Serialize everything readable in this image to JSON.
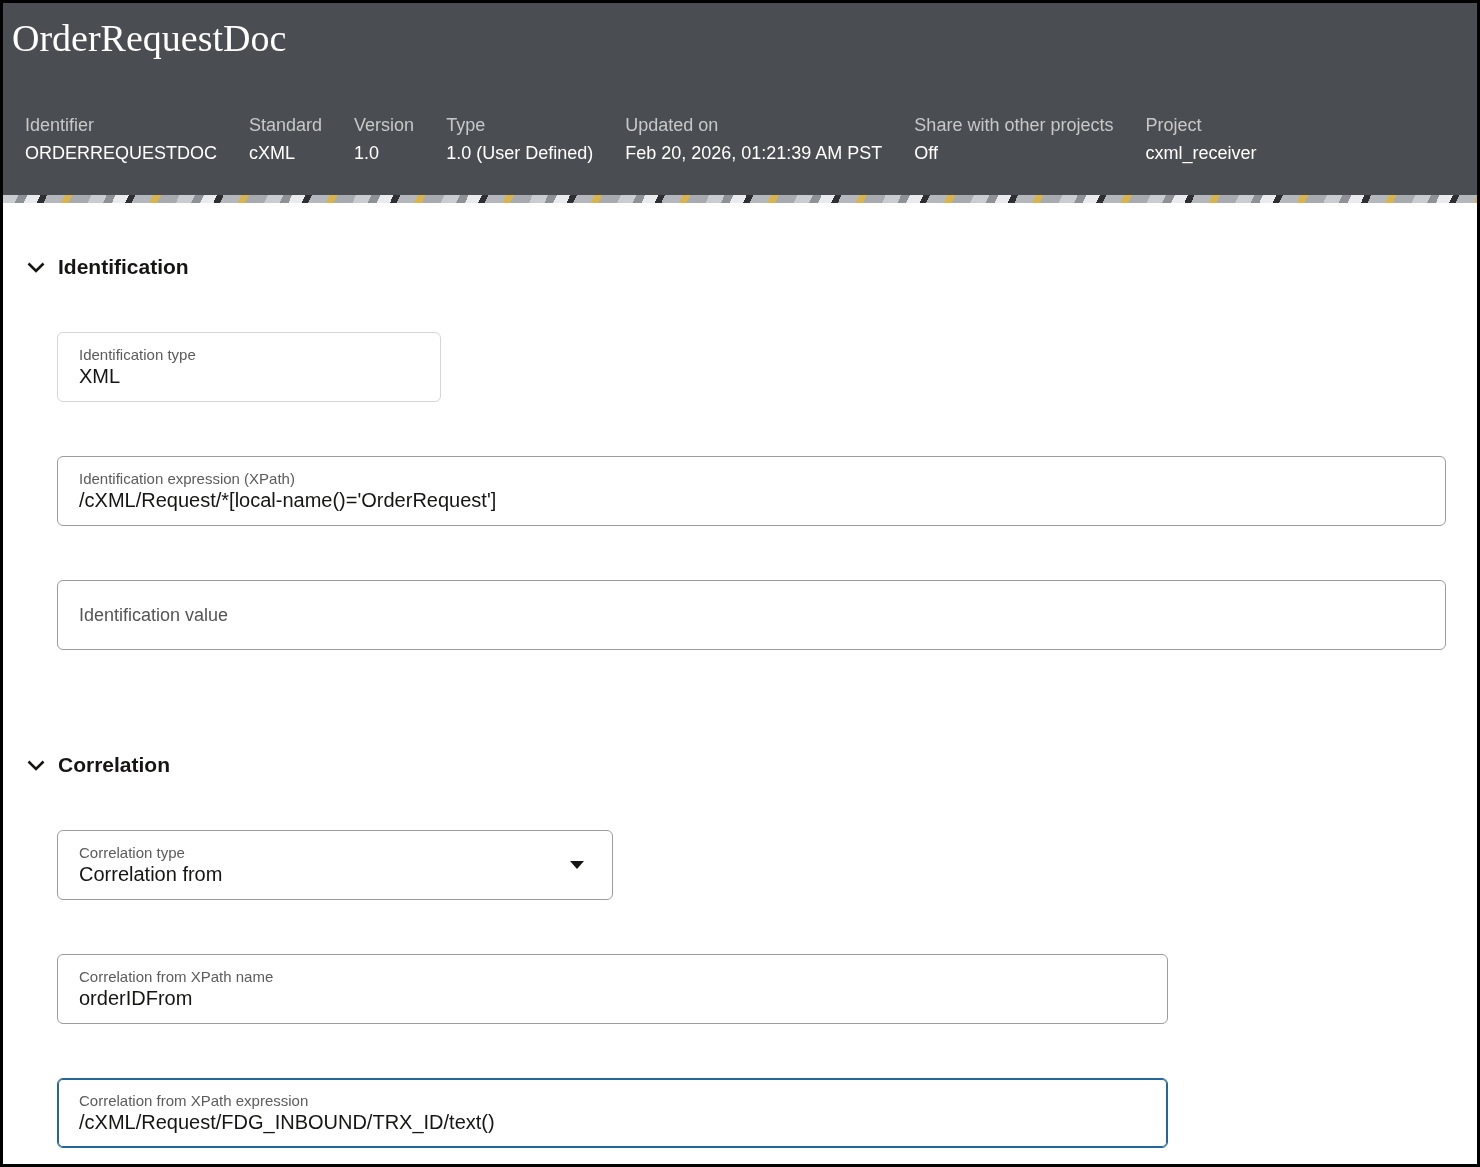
{
  "header": {
    "title": "OrderRequestDoc",
    "meta": [
      {
        "label": "Identifier",
        "value": "ORDERREQUESTDOC"
      },
      {
        "label": "Standard",
        "value": "cXML"
      },
      {
        "label": "Version",
        "value": "1.0"
      },
      {
        "label": "Type",
        "value": "1.0 (User Defined)"
      },
      {
        "label": "Updated on",
        "value": "Feb 20, 2026, 01:21:39 AM PST"
      },
      {
        "label": "Share with other projects",
        "value": "Off"
      },
      {
        "label": "Project",
        "value": "cxml_receiver"
      }
    ]
  },
  "sections": [
    {
      "title": "Identification",
      "expanded": true,
      "fields": [
        {
          "kind": "text",
          "label": "Identification type",
          "value": "XML",
          "readonly": true,
          "focused": false
        },
        {
          "kind": "text",
          "label": "Identification expression (XPath)",
          "value": "/cXML/Request/*[local-name()='OrderRequest']",
          "readonly": false,
          "focused": false
        },
        {
          "kind": "text",
          "placeholder": "Identification value",
          "readonly": false,
          "focused": false
        }
      ]
    },
    {
      "title": "Correlation",
      "expanded": true,
      "fields": [
        {
          "kind": "select",
          "label": "Correlation type",
          "value": "Correlation from",
          "readonly": false,
          "focused": false
        },
        {
          "kind": "text",
          "label": "Correlation from XPath name",
          "value": "orderIDFrom",
          "readonly": false,
          "focused": false
        },
        {
          "kind": "text",
          "label": "Correlation from XPath expression",
          "value": "/cXML/Request/FDG_INBOUND/TRX_ID/text()",
          "readonly": false,
          "focused": true
        }
      ]
    }
  ]
}
